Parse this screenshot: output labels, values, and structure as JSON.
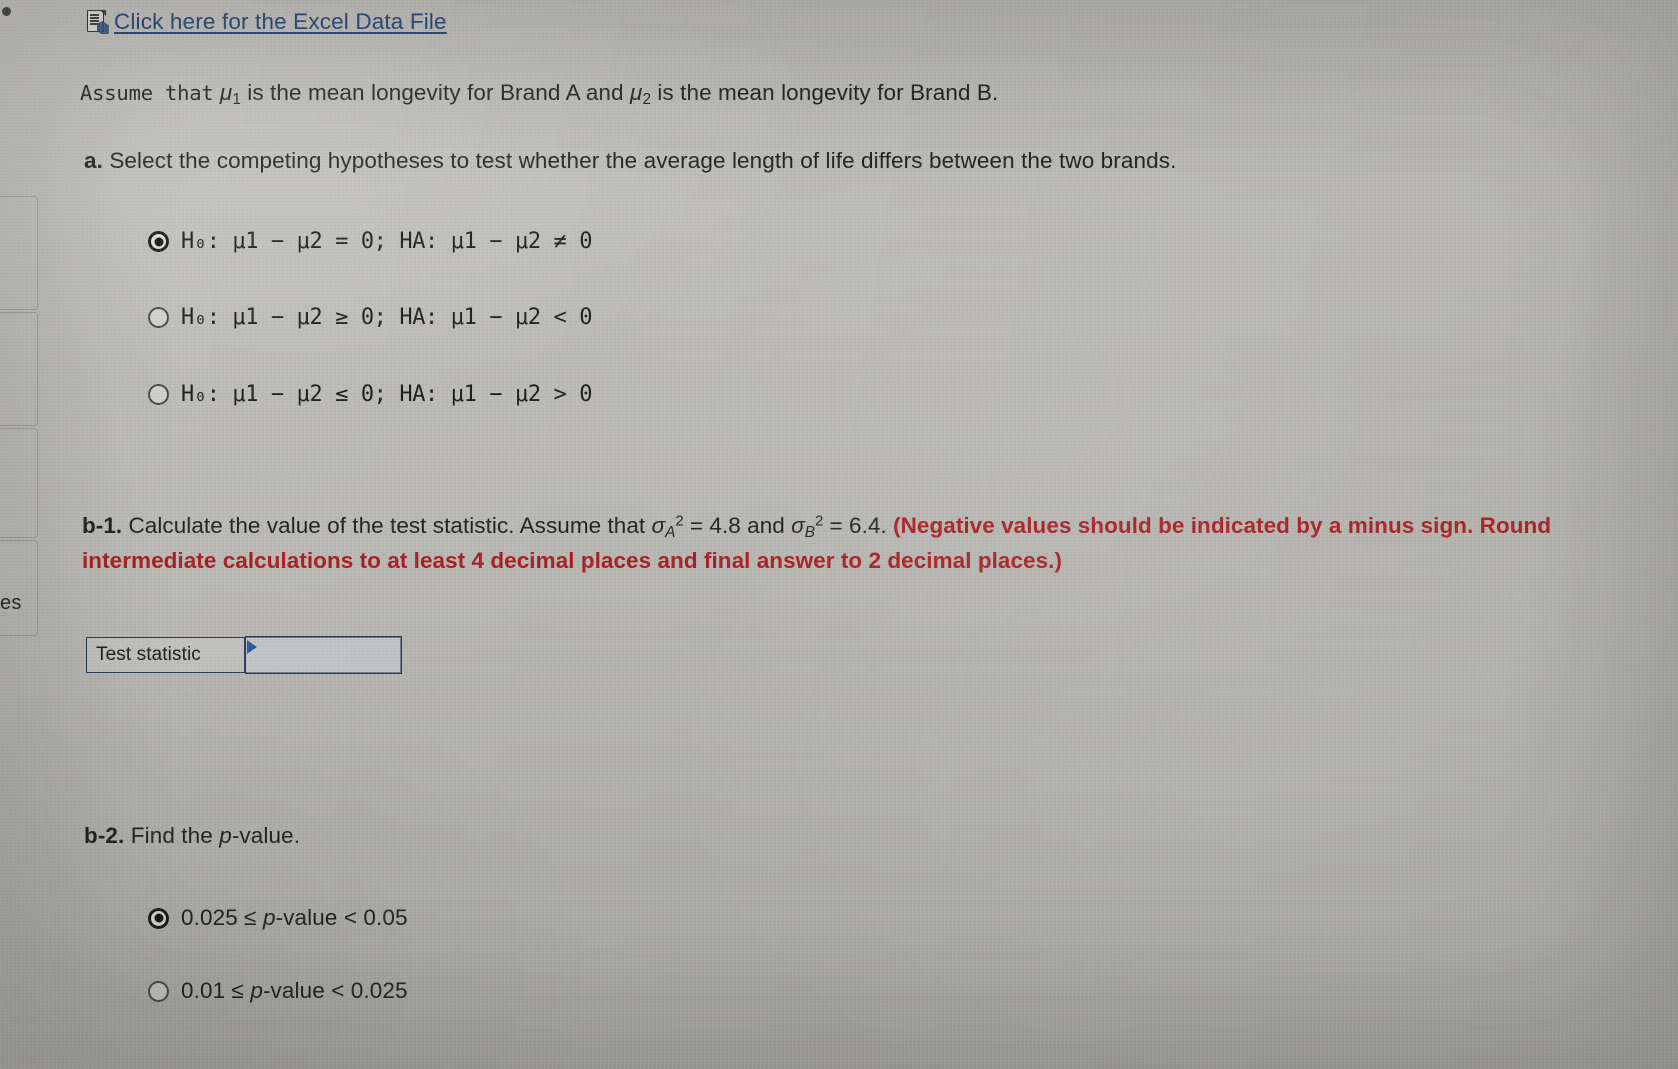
{
  "meta": {
    "accent_link_color": "#1e3f70",
    "instruction_red": "#a81f22",
    "field_border_color": "#2b3a55"
  },
  "edge_panel": {
    "clipped_label": "es"
  },
  "excel_link": {
    "icon": "excel-file-icon",
    "label": "Click here for the Excel Data File"
  },
  "assume_line": {
    "prefix": "Assume that",
    "mu1": "μ",
    "mu1_sub": "1",
    "mid": " is the mean longevity for Brand A and ",
    "mu2": "μ",
    "mu2_sub": "2",
    "suffix": " is the mean longevity for Brand B."
  },
  "part_a": {
    "marker": "a.",
    "prompt": "Select the competing hypotheses to test whether the average length of life differs between the two brands.",
    "selected_index": 0,
    "options": [
      {
        "id": "hyp-equal-notequal",
        "text": "H₀: μ1 − μ2 = 0; HA: μ1 − μ2 ≠ 0",
        "selected": true
      },
      {
        "id": "hyp-ge-less",
        "text": "H₀: μ1 − μ2 ≥ 0; HA: μ1 − μ2 < 0",
        "selected": false
      },
      {
        "id": "hyp-le-greater",
        "text": "H₀: μ1 − μ2 ≤ 0; HA: μ1 − μ2 > 0",
        "selected": false
      }
    ]
  },
  "part_b1": {
    "marker": "b-1.",
    "text_before": " Calculate the value of the test statistic. Assume that ",
    "sigma_a": "σ",
    "sigma_a_sub": "A",
    "sigma_sup": "2",
    "sigma_a_value": " = 4.8 and ",
    "sigma_b": "σ",
    "sigma_b_sub": "B",
    "sigma_b_value": " = 6.4. ",
    "instruction": "(Negative values should be indicated by a minus sign. Round intermediate calculations to at least 4 decimal places and final answer to 2 decimal places.)",
    "answer_row": {
      "label": "Test statistic",
      "value": "",
      "placeholder": ""
    }
  },
  "part_b2": {
    "marker": "b-2.",
    "prompt": " Find the ",
    "prompt_italic": "p",
    "prompt_tail": "-value.",
    "selected_index": 0,
    "options": [
      {
        "id": "pval-025-05",
        "lead": "0.025 ≤ ",
        "ital": "p",
        "tail": "-value < 0.05",
        "selected": true
      },
      {
        "id": "pval-01-025",
        "lead": "0.01 ≤ ",
        "ital": "p",
        "tail": "-value < 0.025",
        "selected": false
      }
    ]
  }
}
